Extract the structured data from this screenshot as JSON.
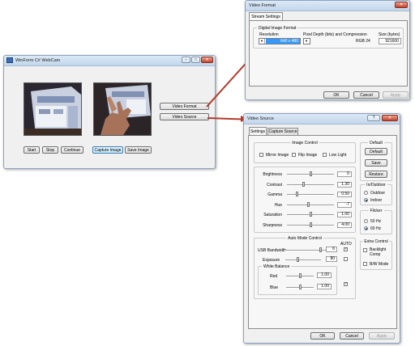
{
  "webcam_window": {
    "title": "WinForm C# WebCam",
    "buttons": {
      "start": "Start",
      "stop": "Stop",
      "continue": "Continue",
      "capture": "Capture Image",
      "save": "Save Image",
      "video_format": "Video Format",
      "video_source": "Video Source"
    }
  },
  "video_format_window": {
    "title": "Video Format",
    "tab": "Stream Settings",
    "group_title": "Digital Image Format",
    "resolution_label": "Resolution",
    "resolution_value": "640 x 480",
    "pixel_label": "Pixel Depth (bits) and Compression",
    "pixel_value": "RGB 24",
    "size_label": "Size (bytes)",
    "size_value": "921600",
    "ok": "OK",
    "cancel": "Cancel",
    "apply": "Apply"
  },
  "video_source_window": {
    "title": "Video Source",
    "tabs": [
      "Settings",
      "Capture Source"
    ],
    "image_control": {
      "title": "Image Control",
      "mirror": "Mirror Image",
      "flip": "Flip Image",
      "lowlight": "Low Light"
    },
    "sliders": [
      {
        "label": "Brightness",
        "value": "0",
        "level": 0.5
      },
      {
        "label": "Contrast",
        "value": "1.30",
        "level": 0.35
      },
      {
        "label": "Gamma",
        "value": "0.50",
        "level": 0.2
      },
      {
        "label": "Hue",
        "value": "-7",
        "level": 0.45
      },
      {
        "label": "Saturation",
        "value": "1.00",
        "level": 0.5
      },
      {
        "label": "Sharpness",
        "value": "4.00",
        "level": 0.5
      }
    ],
    "default_group": {
      "title": "Default",
      "default": "Default",
      "save": "Save",
      "restore": "Restore"
    },
    "inout_group": {
      "title": "In/Outdoor",
      "outdoor": "Outdoor",
      "indoor": "Indoor"
    },
    "flicker_group": {
      "title": "Flicker",
      "hz50": "50 Hz",
      "hz60": "60 Hz"
    },
    "auto_mode": {
      "title": "Auto Mode Control",
      "auto_header": "AUTO",
      "usb_label": "USB Bandwidth",
      "usb_value": "6",
      "exposure_label": "Exposure",
      "exposure_value": "80",
      "white_balance": "White Balance",
      "red_label": "Red",
      "red_value": "1.00",
      "blue_label": "Blue",
      "blue_value": "1.00"
    },
    "extra_control": {
      "title": "Extra Control",
      "backlight": "Backlight Comp",
      "bw": "B/W Mode"
    },
    "ok": "OK",
    "cancel": "Cancel",
    "apply": "Apply"
  },
  "colors": {
    "arrow": "#b23a2a",
    "title_gradient_top": "#dce9f6"
  }
}
